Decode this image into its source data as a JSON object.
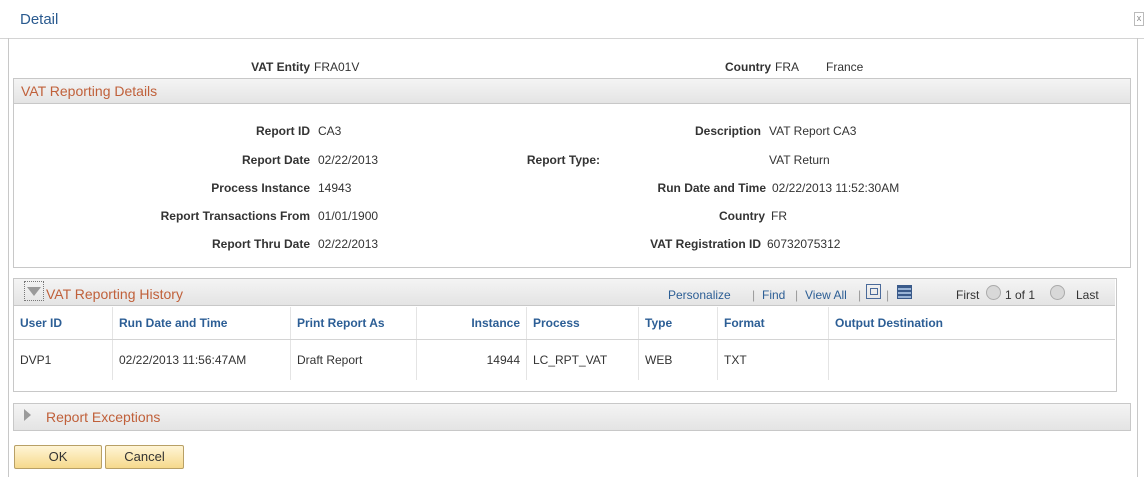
{
  "window": {
    "title": "Detail",
    "close_glyph": "x"
  },
  "header": {
    "vat_entity_label": "VAT Entity",
    "vat_entity_value": "FRA01V",
    "country_label": "Country",
    "country_code": "FRA",
    "country_name": "France"
  },
  "details": {
    "title": "VAT Reporting Details",
    "report_id_label": "Report ID",
    "report_id": "CA3",
    "description_label": "Description",
    "description": "VAT Report CA3",
    "report_date_label": "Report Date",
    "report_date": "02/22/2013",
    "report_type_label": "Report Type:",
    "report_type": "VAT Return",
    "process_instance_label": "Process Instance",
    "process_instance": "14943",
    "run_datetime_label": "Run Date and Time",
    "run_datetime": "02/22/2013 11:52:30AM",
    "txn_from_label": "Report Transactions From",
    "txn_from": "01/01/1900",
    "country_label": "Country",
    "country": "FR",
    "thru_label": "Report Thru Date",
    "thru": "02/22/2013",
    "vat_reg_label": "VAT Registration ID",
    "vat_reg": "60732075312"
  },
  "history": {
    "title": "VAT Reporting History",
    "personalize": "Personalize",
    "find": "Find",
    "view_all": "View All",
    "first": "First",
    "range": "1 of 1",
    "last": "Last",
    "sep": "|",
    "columns": [
      "User ID",
      "Run Date and Time",
      "Print Report As",
      "Instance",
      "Process",
      "Type",
      "Format",
      "Output Destination"
    ],
    "rows": [
      [
        "DVP1",
        "02/22/2013 11:56:47AM",
        "Draft Report",
        "14944",
        "LC_RPT_VAT",
        "WEB",
        "TXT",
        ""
      ]
    ]
  },
  "exceptions": {
    "title": "Report Exceptions"
  },
  "buttons": {
    "ok": "OK",
    "cancel": "Cancel"
  }
}
